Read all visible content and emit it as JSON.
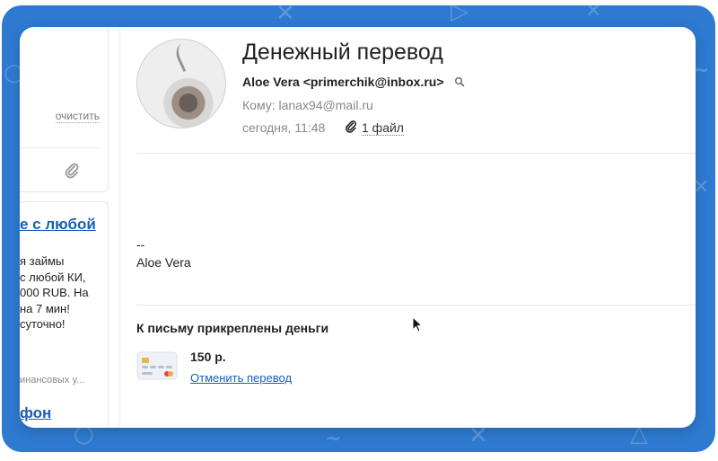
{
  "sidebar": {
    "clear_label": "очистить",
    "ad": {
      "title": "е с любой",
      "text": "я займы\nс любой КИ,\n000 RUB. На\nна 7 мин!\nсуточно!",
      "source": "инансовых у...",
      "title2": "фон"
    }
  },
  "message": {
    "subject": "Денежный перевод",
    "sender": "Aloe Vera <primerchik@inbox.ru>",
    "recipient": "Кому: lanax94@mail.ru",
    "date": "сегодня, 11:48",
    "attachments_label": "1 файл",
    "signature_dash": "--",
    "signature_name": "Aloe Vera"
  },
  "money": {
    "heading": "К письму прикреплены деньги",
    "amount": "150 р.",
    "cancel_label": "Отменить перевод"
  },
  "icons": {
    "attachment": "paperclip-icon",
    "search": "magnifier-icon",
    "card": "bank-card-icon"
  },
  "colors": {
    "background": "#2e7ad1",
    "link": "#1a5eb5",
    "muted": "#888888"
  }
}
